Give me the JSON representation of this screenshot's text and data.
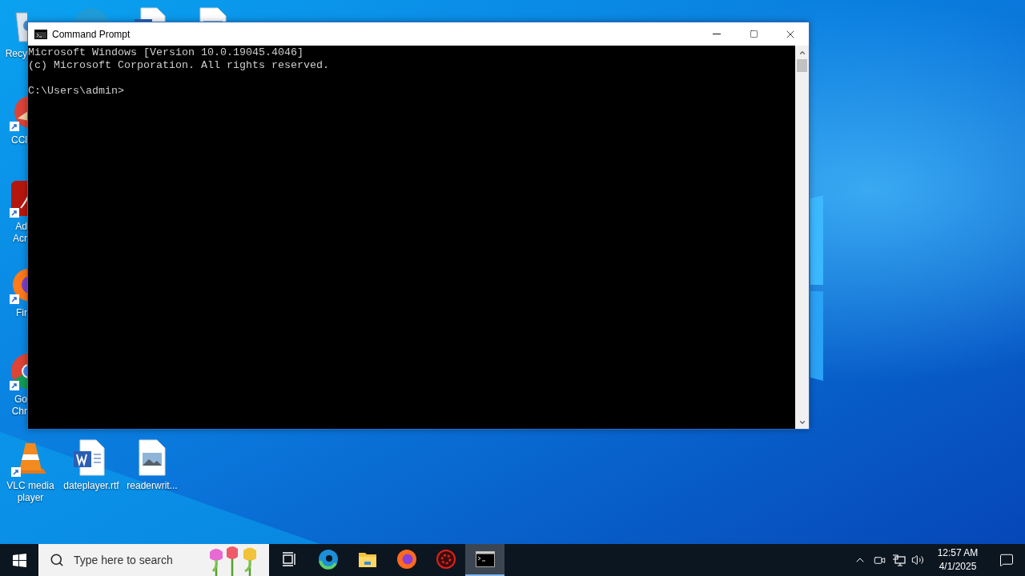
{
  "desktop": {
    "rows": [
      [
        {
          "kind": "recycle",
          "label": [
            "Recy"
          ],
          "shortcut": false,
          "cut": true
        },
        {
          "kind": "edge",
          "shortcut": false,
          "cut": true
        },
        {
          "kind": "word",
          "shortcut": false,
          "cut": true
        },
        {
          "kind": "image-doc",
          "shortcut": false,
          "cut": true
        }
      ],
      [
        {
          "kind": "ccleaner",
          "label": [
            "CCl"
          ],
          "shortcut": true,
          "cut": true
        }
      ],
      [
        {
          "kind": "acrobat",
          "label": [
            "Ad",
            "Acr"
          ],
          "shortcut": true,
          "cut": true
        }
      ],
      [
        {
          "kind": "firefox",
          "label": [
            "Fir"
          ],
          "shortcut": true,
          "cut": true
        }
      ],
      [
        {
          "kind": "chrome",
          "label": [
            "Go",
            "Chr"
          ],
          "shortcut": true,
          "cut": true
        }
      ],
      [
        {
          "kind": "vlc",
          "label": [
            "VLC media",
            "player"
          ],
          "shortcut": true,
          "cut": false
        },
        {
          "kind": "word",
          "label": [
            "dateplayer.rtf"
          ],
          "shortcut": false,
          "cut": false
        },
        {
          "kind": "image-doc",
          "label": [
            "readerwrit..."
          ],
          "shortcut": false,
          "cut": false
        }
      ]
    ]
  },
  "window": {
    "title": "Command Prompt",
    "active": true,
    "console": [
      "Microsoft Windows [Version 10.0.19045.4046]",
      "(c) Microsoft Corporation. All rights reserved."
    ],
    "prompt": "C:\\Users\\admin>"
  },
  "taskbar": {
    "search": {
      "placeholder": "Type here to search"
    },
    "apps": [
      {
        "kind": "task-view",
        "active": false
      },
      {
        "kind": "edge",
        "active": false
      },
      {
        "kind": "folder",
        "active": false
      },
      {
        "kind": "firefox",
        "active": false
      },
      {
        "kind": "red-app",
        "active": false
      },
      {
        "kind": "terminal",
        "active": true
      }
    ],
    "clock": {
      "time": "12:57 AM",
      "date": "4/1/2025"
    }
  }
}
